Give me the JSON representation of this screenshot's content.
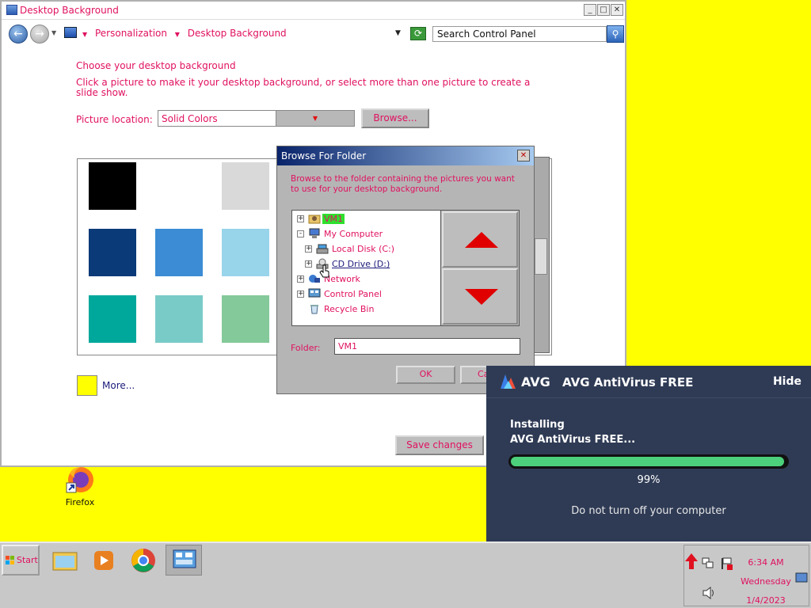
{
  "window": {
    "title": "Desktop Background",
    "breadcrumb": [
      "Personalization",
      "Desktop Background"
    ],
    "search_placeholder": "Search Control Panel"
  },
  "content": {
    "heading": "Choose your desktop background",
    "description": "Click a picture to make it your desktop background, or select more than one picture to create a slide show.",
    "picture_location_label": "Picture location:",
    "picture_location_value": "Solid Colors",
    "browse_label": "Browse...",
    "more_label": "More...",
    "save_label": "Save changes",
    "swatches": [
      "#000000",
      "#ffffff",
      "#d9d9d9",
      "#0b3a78",
      "#3b8cd4",
      "#98d4ea",
      "#00a89c",
      "#79cbc8",
      "#84c99a"
    ]
  },
  "dialog": {
    "title": "Browse For Folder",
    "instructions": "Browse to the folder containing the pictures you want to use for your desktop background.",
    "tree": [
      {
        "label": "VM1",
        "selected": true,
        "expander": "+"
      },
      {
        "label": "My Computer",
        "expander": "-"
      },
      {
        "label": "Local Disk (C:)",
        "expander": "+"
      },
      {
        "label": "CD Drive (D:)",
        "expander": "+"
      },
      {
        "label": "Network",
        "expander": "+"
      },
      {
        "label": "Control Panel",
        "expander": "+"
      },
      {
        "label": "Recycle Bin",
        "expander": ""
      }
    ],
    "folder_label": "Folder:",
    "folder_value": "VM1",
    "ok_label": "OK",
    "cancel_label": "Ca"
  },
  "avg": {
    "brand": "AVG",
    "title": "AVG AntiVirus FREE",
    "hide_label": "Hide",
    "line1": "Installing",
    "line2": "AVG AntiVirus FREE...",
    "progress": 99,
    "progress_text": "99%",
    "warning": "Do not turn off your computer"
  },
  "desktop": {
    "icon_label": "Firefox"
  },
  "taskbar": {
    "start_label": "Start",
    "time": "6:34 AM",
    "day": "Wednesday",
    "date": "1/4/2023"
  },
  "colors": {
    "accent_text": "#e0115f",
    "desktop": "#ffff00",
    "avg_bg": "#2f3b55",
    "avg_progress": "#4cd07c"
  }
}
